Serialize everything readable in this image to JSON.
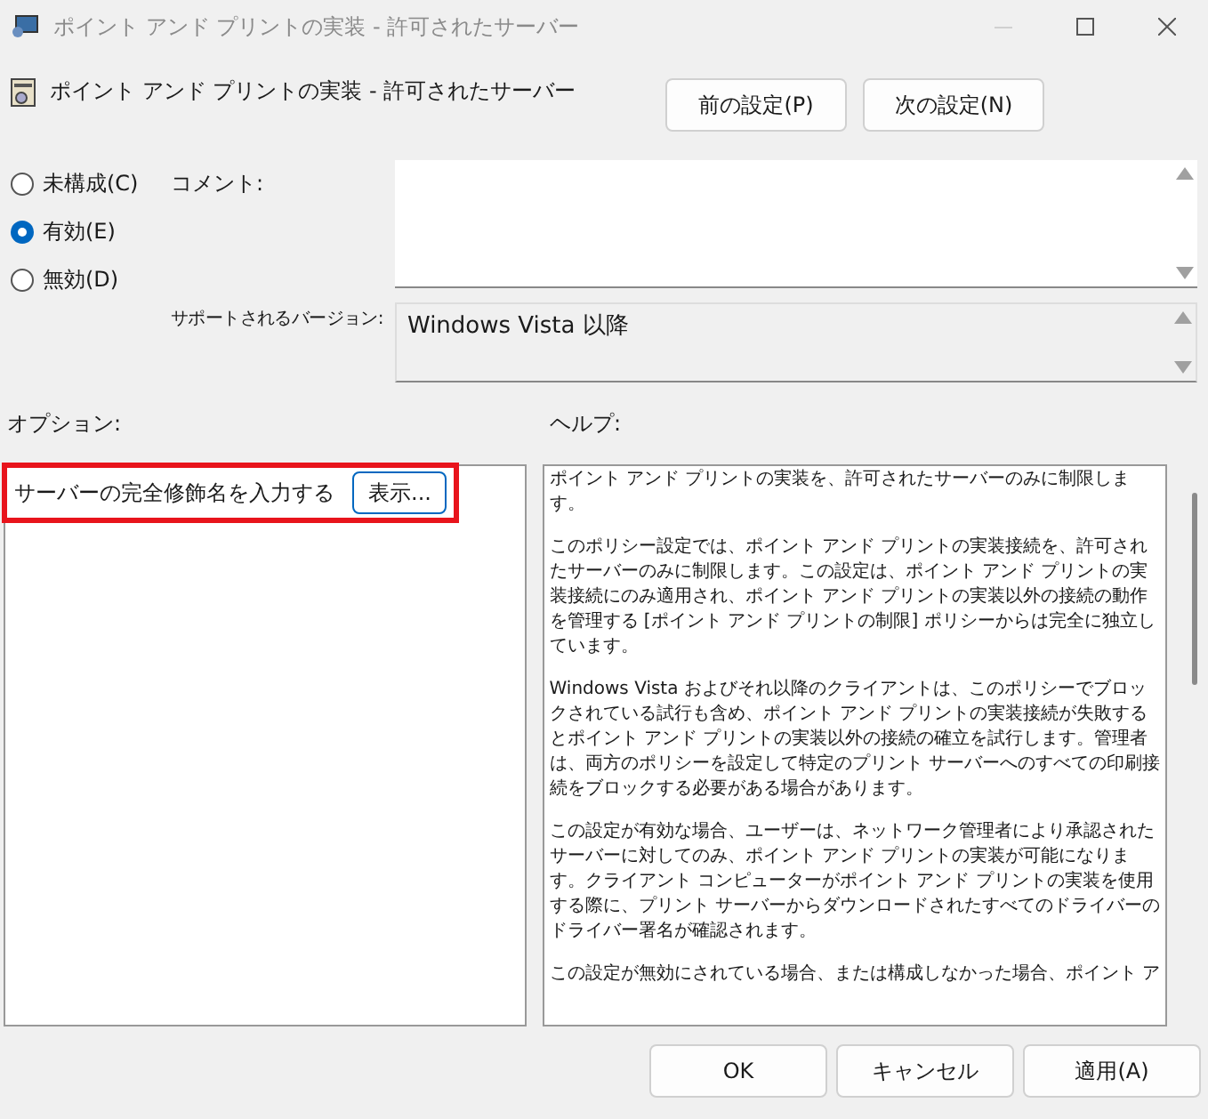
{
  "window": {
    "title": "ポイント アンド プリントの実装 - 許可されたサーバー",
    "minimize_disabled": true
  },
  "policy": {
    "title": "ポイント アンド プリントの実装 - 許可されたサーバー"
  },
  "nav_buttons": [
    "前の設定(P)",
    "次の設定(N)"
  ],
  "state_options": [
    {
      "label": "未構成(C)",
      "selected": false
    },
    {
      "label": "有効(E)",
      "selected": true
    },
    {
      "label": "無効(D)",
      "selected": false
    }
  ],
  "comment": {
    "label": "コメント:"
  },
  "supported": {
    "label": "サポートされるバージョン:",
    "value": "Windows Vista 以降"
  },
  "options": {
    "heading": "オプション:",
    "items": [
      {
        "label": "サーバーの完全修飾名を入力する",
        "button": "表示...",
        "highlighted": true
      }
    ]
  },
  "help": {
    "heading": "ヘルプ:",
    "paragraphs": [
      "ポイント アンド プリントの実装を、許可されたサーバーのみに制限します。",
      "このポリシー設定では、ポイント アンド プリントの実装接続を、許可されたサーバーのみに制限します。この設定は、ポイント アンド プリントの実装接続にのみ適用され、ポイント アンド プリントの実装以外の接続の動作を管理する [ポイント アンド プリントの制限] ポリシーからは完全に独立しています。",
      "Windows Vista およびそれ以降のクライアントは、このポリシーでブロックされている試行も含め、ポイント アンド プリントの実装接続が失敗するとポイント アンド プリントの実装以外の接続の確立を試行します。管理者は、両方のポリシーを設定して特定のプリント サーバーへのすべての印刷接続をブロックする必要がある場合があります。",
      "この設定が有効な場合、ユーザーは、ネットワーク管理者により承認されたサーバーに対してのみ、ポイント アンド プリントの実装が可能になります。クライアント コンピューターがポイント アンド プリントの実装を使用する際に、プリント サーバーからダウンロードされたすべてのドライバーのドライバー署名が確認されます。",
      "この設定が無効にされている場合、または構成しなかった場合、ポイント ア"
    ]
  },
  "footer_buttons": [
    "OK",
    "キャンセル",
    "適用(A)"
  ]
}
